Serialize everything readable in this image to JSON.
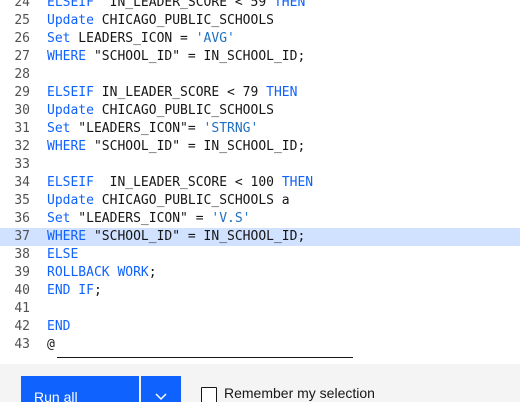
{
  "editor": {
    "active_line": "37",
    "lines": [
      {
        "n": "24",
        "tokens": [
          {
            "t": "ELSEIF",
            "c": "kw"
          },
          {
            "t": "  IN_LEADER_SCORE < 59 ",
            "c": "plain"
          },
          {
            "t": "THEN",
            "c": "kw"
          }
        ]
      },
      {
        "n": "25",
        "tokens": [
          {
            "t": "Update",
            "c": "kw"
          },
          {
            "t": " CHICAGO_PUBLIC_SCHOOLS",
            "c": "plain"
          }
        ]
      },
      {
        "n": "26",
        "tokens": [
          {
            "t": "Set",
            "c": "kw"
          },
          {
            "t": " LEADERS_ICON = ",
            "c": "plain"
          },
          {
            "t": "'AVG'",
            "c": "str"
          }
        ]
      },
      {
        "n": "27",
        "tokens": [
          {
            "t": "WHERE",
            "c": "kw"
          },
          {
            "t": " \"SCHOOL_ID\" = IN_SCHOOL_ID;",
            "c": "plain"
          }
        ]
      },
      {
        "n": "28",
        "tokens": []
      },
      {
        "n": "29",
        "tokens": [
          {
            "t": "ELSEIF",
            "c": "kw"
          },
          {
            "t": " IN_LEADER_SCORE < 79 ",
            "c": "plain"
          },
          {
            "t": "THEN",
            "c": "kw"
          }
        ]
      },
      {
        "n": "30",
        "tokens": [
          {
            "t": "Update",
            "c": "kw"
          },
          {
            "t": " CHICAGO_PUBLIC_SCHOOLS",
            "c": "plain"
          }
        ]
      },
      {
        "n": "31",
        "tokens": [
          {
            "t": "Set",
            "c": "kw"
          },
          {
            "t": " \"LEADERS_ICON\"= ",
            "c": "plain"
          },
          {
            "t": "'STRNG'",
            "c": "str"
          }
        ]
      },
      {
        "n": "32",
        "tokens": [
          {
            "t": "WHERE",
            "c": "kw"
          },
          {
            "t": " \"SCHOOL_ID\" = IN_SCHOOL_ID;",
            "c": "plain"
          }
        ]
      },
      {
        "n": "33",
        "tokens": []
      },
      {
        "n": "34",
        "tokens": [
          {
            "t": "ELSEIF",
            "c": "kw"
          },
          {
            "t": "  IN_LEADER_SCORE < 100 ",
            "c": "plain"
          },
          {
            "t": "THEN",
            "c": "kw"
          }
        ]
      },
      {
        "n": "35",
        "tokens": [
          {
            "t": "Update",
            "c": "kw"
          },
          {
            "t": " CHICAGO_PUBLIC_SCHOOLS a",
            "c": "plain"
          }
        ]
      },
      {
        "n": "36",
        "tokens": [
          {
            "t": "Set",
            "c": "kw"
          },
          {
            "t": " \"LEADERS_ICON\" = ",
            "c": "plain"
          },
          {
            "t": "'V.S'",
            "c": "str"
          }
        ]
      },
      {
        "n": "37",
        "tokens": [
          {
            "t": "WHERE",
            "c": "kw"
          },
          {
            "t": " \"SCHOOL_ID\" = IN_SCHOOL_ID;",
            "c": "plain"
          }
        ]
      },
      {
        "n": "38",
        "tokens": [
          {
            "t": "ELSE",
            "c": "kw"
          }
        ]
      },
      {
        "n": "39",
        "tokens": [
          {
            "t": "ROLLBACK WORK",
            "c": "kw"
          },
          {
            "t": ";",
            "c": "plain"
          }
        ]
      },
      {
        "n": "40",
        "tokens": [
          {
            "t": "END IF",
            "c": "kw"
          },
          {
            "t": ";",
            "c": "plain"
          }
        ]
      },
      {
        "n": "41",
        "tokens": []
      },
      {
        "n": "42",
        "tokens": [
          {
            "t": "END",
            "c": "kw"
          }
        ]
      },
      {
        "n": "43",
        "tokens": [
          {
            "t": "@",
            "c": "plain"
          }
        ]
      }
    ]
  },
  "footer": {
    "run_label": "Run all",
    "dropdown_icon": "chevron-down-icon",
    "checkbox_checked": false,
    "checkbox_label": "Remember my selection"
  },
  "colors": {
    "keyword": "#0f62fe",
    "string": "#1f70c1",
    "text": "#161616",
    "line_number": "#525252",
    "active_line": "#d0e2ff",
    "primary_button": "#0f62fe",
    "footer_bg": "#f4f4f4"
  }
}
